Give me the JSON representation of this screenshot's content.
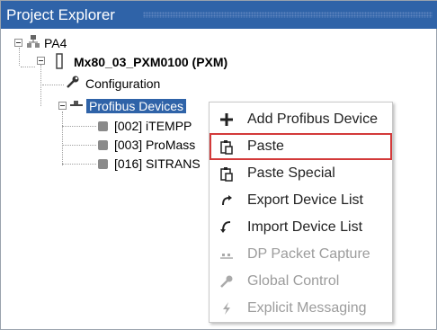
{
  "window": {
    "title": "Project Explorer"
  },
  "tree": {
    "root": "PA4",
    "controller": "Mx80_03_PXM0100 (PXM)",
    "configuration": "Configuration",
    "profibus": "Profibus Devices",
    "devices": [
      "[002] iTEMPP",
      "[003] ProMass",
      "[016] SITRANS"
    ]
  },
  "context_menu": {
    "items": [
      {
        "label": "Add Profibus Device",
        "icon": "plus-icon",
        "enabled": true
      },
      {
        "label": "Paste",
        "icon": "paste-icon",
        "enabled": true,
        "highlighted": true
      },
      {
        "label": "Paste Special",
        "icon": "paste-special-icon",
        "enabled": true
      },
      {
        "label": "Export Device List",
        "icon": "export-arrow-icon",
        "enabled": true
      },
      {
        "label": "Import Device List",
        "icon": "import-arrow-icon",
        "enabled": true
      },
      {
        "label": "DP Packet Capture",
        "icon": "packet-capture-icon",
        "enabled": false
      },
      {
        "label": "Global Control",
        "icon": "global-control-icon",
        "enabled": false
      },
      {
        "label": "Explicit Messaging",
        "icon": "lightning-icon",
        "enabled": false
      }
    ]
  },
  "colors": {
    "title_bar": "#2f63a8",
    "selection": "#2f63a8",
    "highlight_border": "#d33a3a"
  }
}
